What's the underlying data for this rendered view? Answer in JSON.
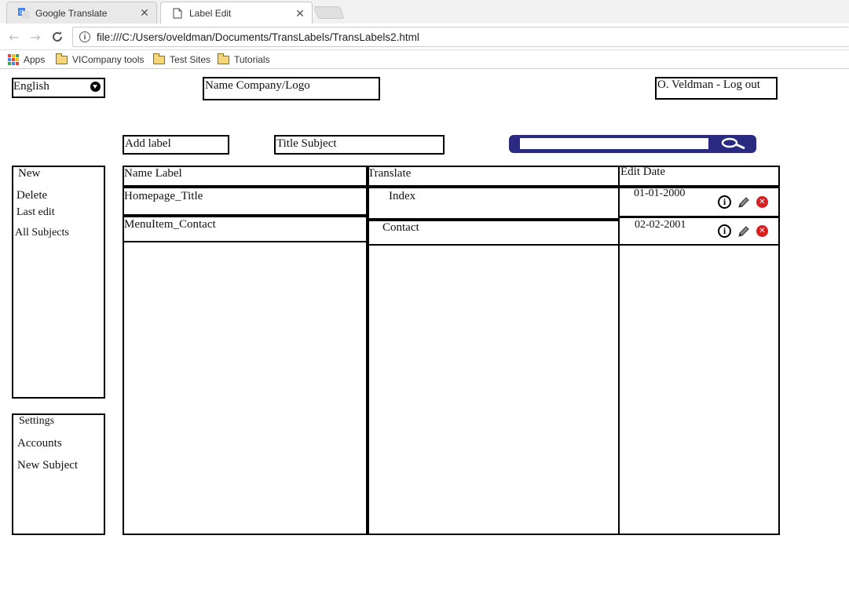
{
  "browser": {
    "tabs": [
      {
        "title": "Google Translate",
        "active": false
      },
      {
        "title": "Label Edit",
        "active": true
      }
    ],
    "address": "file:///C:/Users/oveldman/Documents/TransLabels/TransLabels2.html",
    "bookmarks": [
      "Apps",
      "VICompany tools",
      "Test Sites",
      "Tutorials"
    ]
  },
  "header": {
    "language": "English",
    "company": "Name Company/Logo",
    "user": "O. Veldman - Log out"
  },
  "toolbar": {
    "add_label": "Add label",
    "title_subject": "Title Subject",
    "search_value": ""
  },
  "sidebar": {
    "menu": [
      "New",
      "Delete",
      "Last edit",
      "All Subjects"
    ],
    "settings": [
      "Settings",
      "Accounts",
      "New Subject"
    ]
  },
  "table": {
    "columns": [
      "Name Label",
      "Translate",
      "Edit Date"
    ],
    "rows": [
      {
        "name": "Homepage_Title",
        "translate": "Index",
        "date": "01-01-2000"
      },
      {
        "name": "MenuItem_Contact",
        "translate": "Contact",
        "date": "02-02-2001"
      }
    ]
  },
  "colors": {
    "search_bar": "#2a2a80",
    "delete_icon": "#d81e1e"
  }
}
